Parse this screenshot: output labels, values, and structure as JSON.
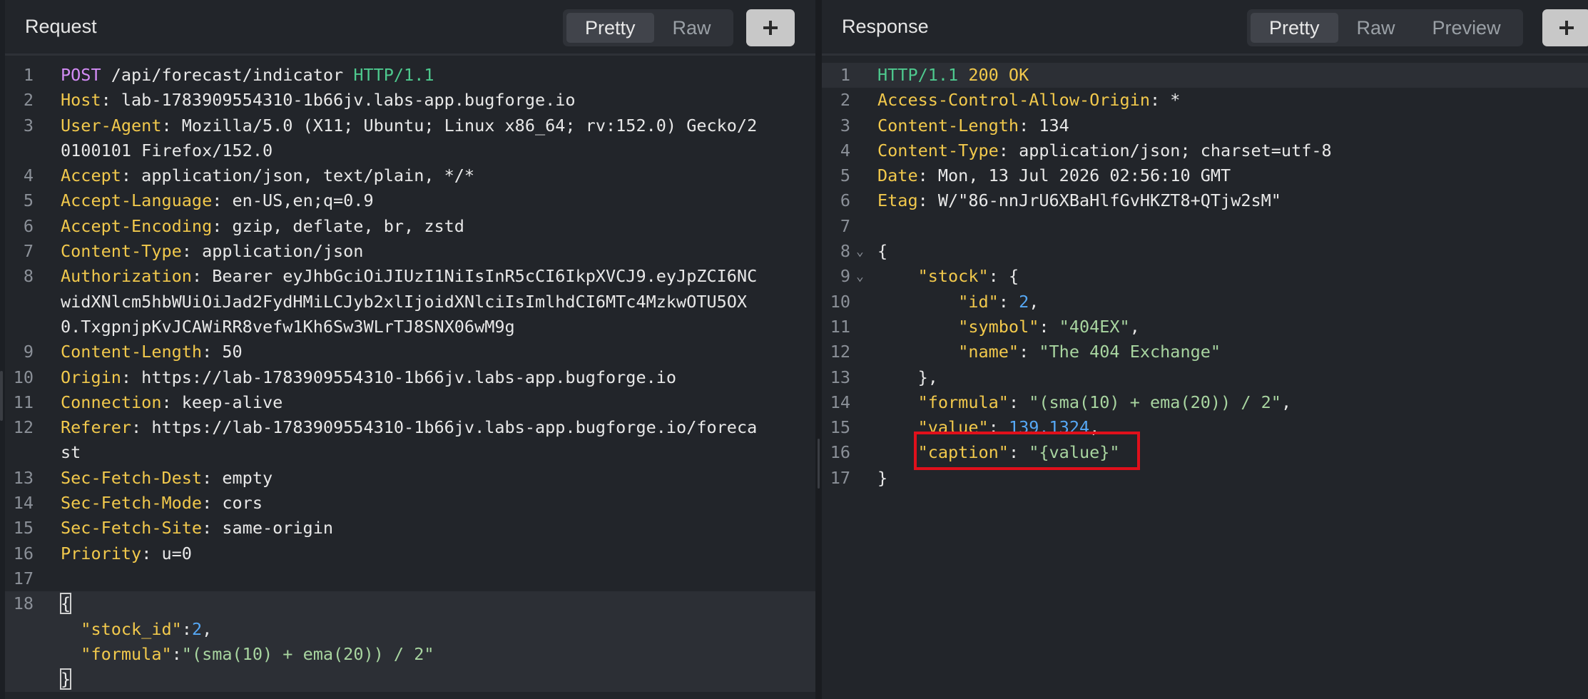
{
  "request": {
    "title": "Request",
    "tabs": [
      "Pretty",
      "Raw"
    ],
    "active_tab": "Pretty",
    "lines": [
      {
        "n": "1",
        "method": "POST",
        "path": " /api/forecast/indicator ",
        "ver": "HTTP/1.1"
      },
      {
        "n": "2",
        "key": "Host",
        "val": ": lab-1783909554310-1b66jv.labs-app.bugforge.io"
      },
      {
        "n": "3",
        "key": "User-Agent",
        "val": ": Mozilla/5.0 (X11; Ubuntu; Linux x86_64; rv:152.0) Gecko/2"
      },
      {
        "n": "",
        "val": "0100101 Firefox/152.0"
      },
      {
        "n": "4",
        "key": "Accept",
        "val": ": application/json, text/plain, */*"
      },
      {
        "n": "5",
        "key": "Accept-Language",
        "val": ": en-US,en;q=0.9"
      },
      {
        "n": "6",
        "key": "Accept-Encoding",
        "val": ": gzip, deflate, br, zstd"
      },
      {
        "n": "7",
        "key": "Content-Type",
        "val": ": application/json"
      },
      {
        "n": "8",
        "key": "Authorization",
        "val": ": Bearer eyJhbGciOiJIUzI1NiIsInR5cCI6IkpXVCJ9.eyJpZCI6NC"
      },
      {
        "n": "",
        "val": "widXNlcm5hbWUiOiJad2FydHMiLCJyb2xlIjoidXNlciIsImlhdCI6MTc4MzkwOTU5OX"
      },
      {
        "n": "",
        "val": "0.TxgpnjpKvJCAWiRR8vefw1Kh6Sw3WLrTJ8SNX06wM9g"
      },
      {
        "n": "9",
        "key": "Content-Length",
        "val": ": 50"
      },
      {
        "n": "10",
        "key": "Origin",
        "val": ": https://lab-1783909554310-1b66jv.labs-app.bugforge.io"
      },
      {
        "n": "11",
        "key": "Connection",
        "val": ": keep-alive"
      },
      {
        "n": "12",
        "key": "Referer",
        "val": ": https://lab-1783909554310-1b66jv.labs-app.bugforge.io/foreca"
      },
      {
        "n": "",
        "val": "st"
      },
      {
        "n": "13",
        "key": "Sec-Fetch-Dest",
        "val": ": empty"
      },
      {
        "n": "14",
        "key": "Sec-Fetch-Mode",
        "val": ": cors"
      },
      {
        "n": "15",
        "key": "Sec-Fetch-Site",
        "val": ": same-origin"
      },
      {
        "n": "16",
        "key": "Priority",
        "val": ": u=0"
      },
      {
        "n": "17"
      },
      {
        "n": "18",
        "bracket": "{",
        "hl": true
      },
      {
        "n": "",
        "hl": true,
        "indent": "  ",
        "jkey": "\"stock_id\"",
        "sep": ":",
        "num": "2",
        "tail": ","
      },
      {
        "n": "",
        "hl": true,
        "indent": "  ",
        "jkey": "\"formula\"",
        "sep": ":",
        "str": "\"(sma(10) + ema(20)) / 2\""
      },
      {
        "n": "",
        "hl": true,
        "bracket": "}"
      }
    ]
  },
  "response": {
    "title": "Response",
    "tabs": [
      "Pretty",
      "Raw",
      "Preview"
    ],
    "active_tab": "Pretty",
    "lines": [
      {
        "n": "1",
        "status_ver": "HTTP/1.1",
        "status": " 200 OK",
        "hl": true
      },
      {
        "n": "2",
        "key": "Access-Control-Allow-Origin",
        "val": ": *"
      },
      {
        "n": "3",
        "key": "Content-Length",
        "val": ": 134"
      },
      {
        "n": "4",
        "key": "Content-Type",
        "val": ": application/json; charset=utf-8"
      },
      {
        "n": "5",
        "key": "Date",
        "val": ": Mon, 13 Jul 2026 02:56:10 GMT"
      },
      {
        "n": "6",
        "key": "Etag",
        "val": ": W/\"86-nnJrU6XBaHlfGvHKZT8+QTjw2sM\""
      },
      {
        "n": "7"
      },
      {
        "n": "8",
        "fold": "⌄",
        "plain": "{"
      },
      {
        "n": "9",
        "fold": "⌄",
        "indent": "    ",
        "jkey": "\"stock\"",
        "sep": ": ",
        "plaintail": "{"
      },
      {
        "n": "10",
        "indent": "        ",
        "jkey": "\"id\"",
        "sep": ": ",
        "num": "2",
        "tail": ","
      },
      {
        "n": "11",
        "indent": "        ",
        "jkey": "\"symbol\"",
        "sep": ": ",
        "str": "\"404EX\"",
        "tail": ","
      },
      {
        "n": "12",
        "indent": "        ",
        "jkey": "\"name\"",
        "sep": ": ",
        "str": "\"The 404 Exchange\""
      },
      {
        "n": "13",
        "indent": "    ",
        "plain": "},"
      },
      {
        "n": "14",
        "indent": "    ",
        "jkey": "\"formula\"",
        "sep": ": ",
        "str": "\"(sma(10) + ema(20)) / 2\"",
        "tail": ","
      },
      {
        "n": "15",
        "indent": "    ",
        "jkey": "\"value\"",
        "sep": ": ",
        "num": "139.1324",
        "tail": ","
      },
      {
        "n": "16",
        "indent": "    ",
        "jkey": "\"caption\"",
        "sep": ": ",
        "str": "\"{value}\""
      },
      {
        "n": "17",
        "plain": "}"
      }
    ]
  },
  "colors": {
    "keyword": "#f2c94c",
    "string": "#a8d5a0",
    "number": "#56a8f5",
    "method": "#d38cf5",
    "version": "#4ec98e",
    "highlight_box": "#e0101b"
  },
  "icons": {
    "add": "plus-icon",
    "fold": "chevron-down-icon"
  }
}
